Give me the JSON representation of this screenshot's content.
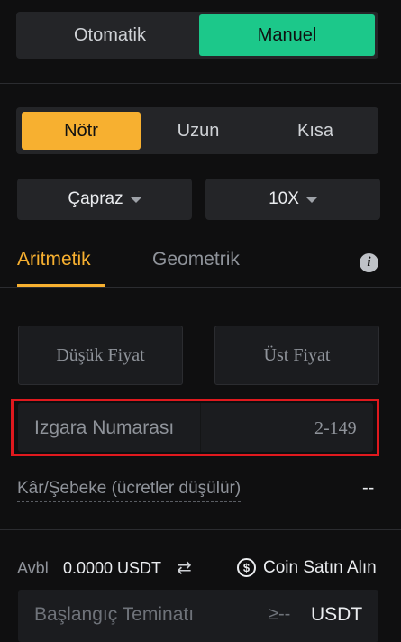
{
  "mode": {
    "auto_label": "Otomatik",
    "manual_label": "Manuel",
    "selected": "Manuel"
  },
  "direction": {
    "options": [
      "Nötr",
      "Uzun",
      "Kısa"
    ],
    "selected": "Nötr"
  },
  "margin_mode": {
    "value": "Çapraz"
  },
  "leverage": {
    "value": "10X"
  },
  "tabs": {
    "arithmetic": "Aritmetik",
    "geometric": "Geometrik",
    "selected": "Aritmetik"
  },
  "price": {
    "low_placeholder": "Düşük Fiyat",
    "high_placeholder": "Üst Fiyat"
  },
  "grid": {
    "label": "Izgara Numarası",
    "range": "2-149"
  },
  "profit": {
    "label": "Kâr/Şebeke (ücretler düşülür)",
    "value": "--"
  },
  "balance": {
    "label": "Avbl",
    "value": "0.0000 USDT",
    "swap_icon": "⇄",
    "buy_label": "Coin Satın Alın"
  },
  "start_margin": {
    "placeholder": "Başlangıç Teminatı",
    "min": "≥--",
    "unit": "USDT"
  },
  "colors": {
    "accent_green": "#1cc88a",
    "accent_yellow": "#f7b030",
    "highlight_red": "#e0191e",
    "background": "#0f0f10"
  }
}
